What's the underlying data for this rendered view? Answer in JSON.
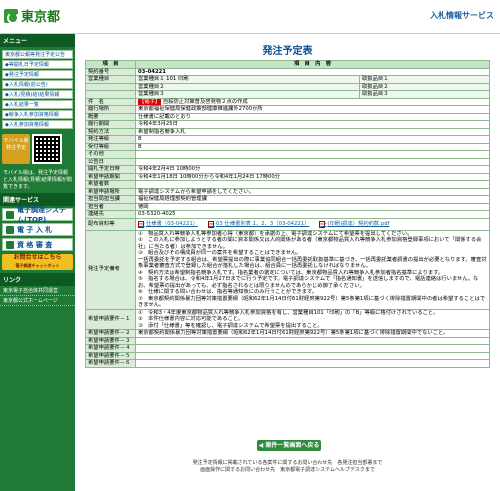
{
  "header": {
    "logo_text": "東京都",
    "service_title": "入札情報サービス"
  },
  "sidebar": {
    "menu_head": "メニュー",
    "menu_items": [
      "東京都公報等発注予定公告",
      "◆等開札日予定情報",
      "◆発注予定情報",
      "◆入札情報(前公告)",
      "◆入札/見積(結)結果情報",
      "◆入札結果一覧",
      "◆競争入札参加資格情報",
      "◆入札参加資格情報"
    ],
    "mobile_label": "モバイル版",
    "mobile_sub": "発注予定",
    "mobile_note": "モバイル版は、発注予定情報と入札情報(見積)結果情報が閲覧できます。",
    "link_head": "関連サービス",
    "big_links": [
      "電子調達システム(TOP)",
      "電 子 入 札",
      "資 格 審 査"
    ],
    "chat_label": "お問合せはこちら",
    "chat_sub": "電子調達チャットボット",
    "links_head": "リンク",
    "links": [
      "東京電子自治体共同運営",
      "東京都公式ホームページ"
    ]
  },
  "main": {
    "title": "発注予定表",
    "col_item": "項　目",
    "col_content": "項　目　内　容",
    "rows": [
      {
        "label": "契約番号",
        "value": "03-04221"
      },
      {
        "label": "営業種目",
        "value": "営業種目１ 101 印刷",
        "extra": "取扱品目１"
      },
      {
        "label": "",
        "value": "営業種目２",
        "extra": "取扱品目２"
      },
      {
        "label": "",
        "value": "営業種目３",
        "extra": "取扱品目３"
      },
      {
        "label": "件　名",
        "badge": "【電子】",
        "value": "自殺防止対策普及啓発物２点の作成"
      },
      {
        "label": "履行場所",
        "value": "東京都福祉保健局保健政策部健康推進課外2700か所"
      },
      {
        "label": "概要",
        "value": "仕様書に記載のとおり"
      },
      {
        "label": "履行期間",
        "value": "令和4年3月25日"
      },
      {
        "label": "契約方法",
        "value": "希望制指名競争入札"
      },
      {
        "label": "発注等級",
        "value": "B"
      },
      {
        "label": "受付等級",
        "value": "B"
      },
      {
        "label": "その他",
        "value": ""
      },
      {
        "label": "公告日",
        "value": ""
      },
      {
        "label": "開札予定日時",
        "value": "令和4年2月4日 10時00分"
      },
      {
        "label": "希望申請期間",
        "value": "令和4年1月18日 10時00分から令和4年1月24日 17時00分"
      },
      {
        "label": "希望者数",
        "value": ""
      },
      {
        "label": "希望申請場所",
        "value": "電子調達システムから希望申請をしてください。"
      },
      {
        "label": "担当局担当課",
        "value": "福祉保健局経理部契約管理課"
      },
      {
        "label": "担当者",
        "value": "徳岡"
      },
      {
        "label": "連絡先",
        "value": "03-5320-4025"
      }
    ],
    "files_label": "配布資料等",
    "files": [
      "仕様書（03-04221）",
      "03 仕様書別表 1、2、3（03-04221）",
      "(印刷)調達）契約約款.pdf"
    ],
    "notes_label": "発注予定備考",
    "notes": [
      "①　物品買入れ等競争入札等参加者心得（東京都）を承諾の上、電子調達システムにて希望票を提出してください。",
      "②　この入札に参加しようとする者の間に資本関係又は人的関係がある者（東京都物品買入れ等競争入札参加資格登録事項において「関係する会社」に当たる者）は参加できません。",
      "③　組合及びその構成員が同一の案件を希望することはできません。",
      "一括再委託を予定する組合は、希望票提出の際に事業協同組合一括再委託取扱基準に基づき、一括再委託業者調書の提出が必要となります。審査対象事業者審査方式で登録した組合が落札した場合は、組合員に一括再委託しなければなりません。",
      "④　契約方法は希望制指名競争入札です。指名業者の選定については、東京都物品買入れ等競争入札参加者指名基準によります。",
      "⑤　指名する場合は、令和4年1月27日までに行う予定です。電子調達システムで「指名通知書」を送信しますので、電話連絡は行いません。なお、希望票の提出があっても、必ず指名されるとは限りませんのであらかじめ御了承ください。",
      "⑥　仕様に関する問い合わせは、指名等通知後にのみ行うことができます。",
      "⑦　東京都契約関係暴力団等対策措置要綱（昭和62年1月14日付61財経庶第922号）第5条第1項に基づく排除措置期間中の者は希望することはできません。"
    ],
    "req1_label": "希望申請要件－１",
    "req1": [
      "①　令和3・4年度東京都物品買入れ等競争入札参加資格を有し、営業種目101「印刷」の「B」等級に格付けされていること。",
      "②　本件仕様書内容に対応可能であること。",
      "③　添付「仕様書」等を確認し、電子調達システムで希望票を提出すること。"
    ],
    "req2_label": "希望申請要件－２",
    "req2": "東京都契約関係暴力団等対策措置要綱（昭和62年1月14日付61財経庶第922号）第5条第1項に基づく排除措置期間中でないこと。",
    "req_labels": [
      "希望申請要件－３",
      "希望申請要件－４",
      "希望申請要件－５",
      "希望申請要件－６"
    ],
    "back_button": "◀ 案件一覧画面へ戻る",
    "footer_line1": "発注予定情報に掲載されている各案件に関するお問い合わせ先　各発注担当部署まで",
    "footer_line2": "画面操作に関するお問い合わせ先　東京都電子調達システムヘルプデスクまで"
  }
}
